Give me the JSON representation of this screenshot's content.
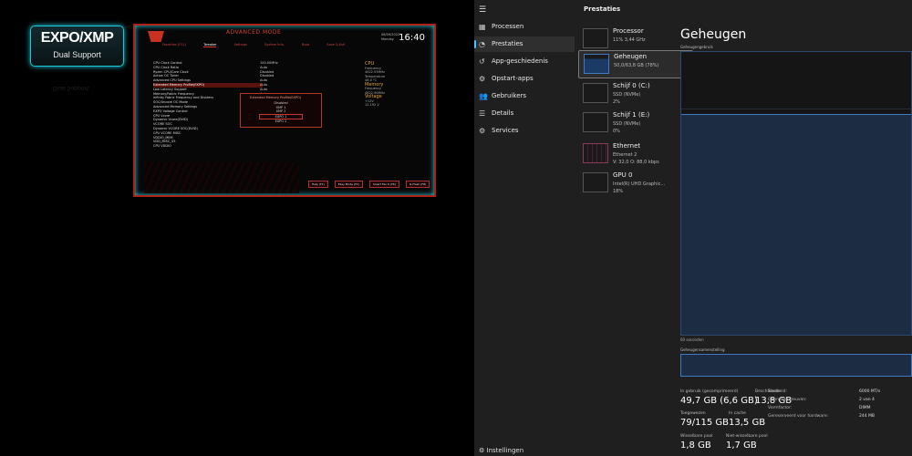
{
  "left_image": {
    "badge_title": "EXPO/XMP",
    "badge_sub": "Dual Support",
    "bios_title": "ADVANCED MODE",
    "bios_date": "08/09/2022 Monday",
    "bios_clock": "16:40",
    "bios_tabs": [
      "Favorites (F11)",
      "Tweaker",
      "Settings",
      "System Info.",
      "Boot",
      "Save & Exit"
    ],
    "bios_rows": [
      "CPU Clock Control",
      "CPU Clock Ratio",
      "Ryzen CPU/Core Clock",
      "Active OC Tuner",
      "Advanced CPU Settings",
      "Extended Memory Profile(EXPO)",
      "Low Latency Support",
      "Memory/Fabric Frequency",
      "Infinity Fabric Frequency and Dividers",
      "SOC/Uncore OC Mode",
      "Advanced Memory Settings",
      "EXPO Voltage Control",
      "CPU Vcore",
      "Dynamic Vcore(DVID)",
      "VCORE SOC",
      "Dynamic VCORE SOC(DVID)",
      "CPU VCORE MISC",
      "VDDIO_MEM",
      "VDD_MISC_S5",
      "CPU VDDIO"
    ],
    "bios_values": [
      "100.00MHz",
      "Auto",
      "Disabled",
      "Disabled",
      "Auto",
      "Auto",
      "Auto",
      "Auto"
    ],
    "popup_title": "Extended Memory Profile(EXPO)",
    "popup_items": [
      "Disabled",
      "XMP 1",
      "XMP 2",
      "EXPO 1",
      "EXPO 2"
    ],
    "right_panel": [
      "CPU",
      "Frequency",
      "4622.93MHz",
      "Temperature",
      "48.0 °C",
      "Memory",
      "Frequency",
      "4822.90MHz",
      "Voltage",
      "+12V",
      "12.192 V"
    ],
    "bottom_buttons": [
      "Help (F1)",
      "Easy Mode (F2)",
      "Smart Fan 6 (F6)",
      "Q-Flash (F8)"
    ]
  },
  "task_manager": {
    "nav": [
      {
        "label": "Processen",
        "icon": "processes-icon",
        "glyph": "▦"
      },
      {
        "label": "Prestaties",
        "icon": "performance-icon",
        "glyph": "◔"
      },
      {
        "label": "App-geschiedenis",
        "icon": "history-icon",
        "glyph": "↺"
      },
      {
        "label": "Opstart-apps",
        "icon": "startup-icon",
        "glyph": "⚙"
      },
      {
        "label": "Gebruikers",
        "icon": "users-icon",
        "glyph": "👥"
      },
      {
        "label": "Details",
        "icon": "details-icon",
        "glyph": "☰"
      },
      {
        "label": "Services",
        "icon": "services-icon",
        "glyph": "⚙"
      }
    ],
    "settings_label": "Instellingen",
    "section_title": "Prestaties",
    "cards": [
      {
        "name": "Processor",
        "l2": "11% 3,44 GHz",
        "l3": ""
      },
      {
        "name": "Geheugen",
        "l2": "50,0/63,8 GB (78%)",
        "l3": ""
      },
      {
        "name": "Schijf 0 (C:)",
        "l2": "SSD (NVMe)",
        "l3": "2%"
      },
      {
        "name": "Schijf 1 (E:)",
        "l2": "SSD (NVMe)",
        "l3": "0%"
      },
      {
        "name": "Ethernet",
        "l2": "Ethernet 2",
        "l3": "V: 32,0 O: 88,0 kbps"
      },
      {
        "name": "GPU 0",
        "l2": "Intel(R) UHD Graphic...",
        "l3": "18%"
      }
    ],
    "main_title": "Geheugen",
    "graph_label": "Geheugengebruik",
    "graph_fill_fraction": 0.78,
    "graph_left_label": "60 seconden",
    "composition_label": "Geheugensamenstelling",
    "stats": [
      {
        "label": "In gebruik (gecomprimeerd)",
        "value": "49,7 GB (6,6 GB)"
      },
      {
        "label": "Beschikbaar",
        "value": "13,8 GB"
      },
      {
        "label": "Toegewezen",
        "value": "79/115 GB"
      },
      {
        "label": "In cache",
        "value": "13,5 GB"
      },
      {
        "label": "Wisselbare pool",
        "value": "1,8 GB"
      },
      {
        "label": "Niet-wisselbare pool",
        "value": "1,7 GB"
      }
    ],
    "kv": [
      {
        "k": "Snelheid:",
        "v": "6000 MT/s"
      },
      {
        "k": "Gebruikte sleuven:",
        "v": "2 van 4"
      },
      {
        "k": "Vormfactor:",
        "v": "DIMM"
      },
      {
        "k": "Gereserveerd voor hardware:",
        "v": "244 MB"
      }
    ]
  }
}
